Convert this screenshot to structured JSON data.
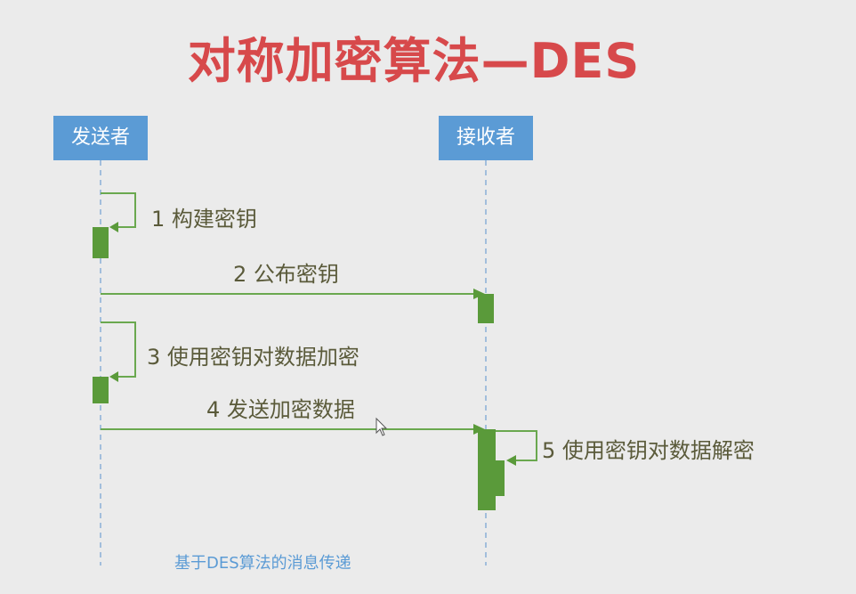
{
  "title": "对称加密算法—DES",
  "actors": {
    "sender": "发送者",
    "receiver": "接收者"
  },
  "messages": [
    {
      "label": "1 构建密钥"
    },
    {
      "label": "2 公布密钥"
    },
    {
      "label": "3 使用密钥对数据加密"
    },
    {
      "label": "4 发送加密数据"
    },
    {
      "label": "5 使用密钥对数据解密"
    }
  ],
  "caption": "基于DES算法的消息传递",
  "colors": {
    "title": "#d7494b",
    "actor_fill": "#5b9bd5",
    "activation": "#5a9a3a",
    "message_line": "#6aa84f",
    "lifeline": "#8ab0d8",
    "caption": "#5b9bd5"
  }
}
